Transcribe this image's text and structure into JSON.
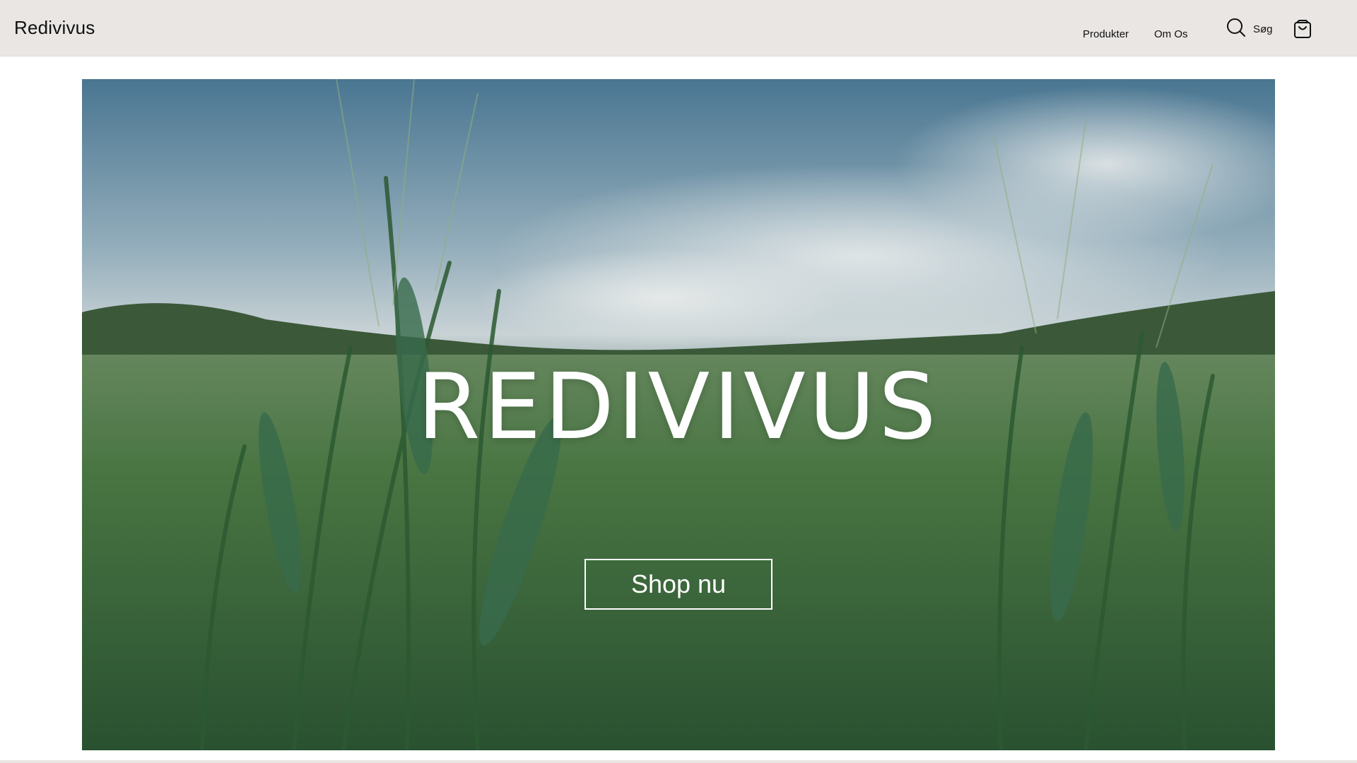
{
  "header": {
    "brand": "Redivivus",
    "nav": [
      {
        "label": "Produkter"
      },
      {
        "label": "Om Os"
      }
    ],
    "search_label": "Søg",
    "icons": {
      "search": "search-icon",
      "cart": "shopping-bag-icon"
    }
  },
  "hero": {
    "title": "REDIVIVUS",
    "cta_label": "Shop nu"
  },
  "colors": {
    "topbar_bg": "#e9e6e4",
    "hero_text": "#ffffff"
  }
}
